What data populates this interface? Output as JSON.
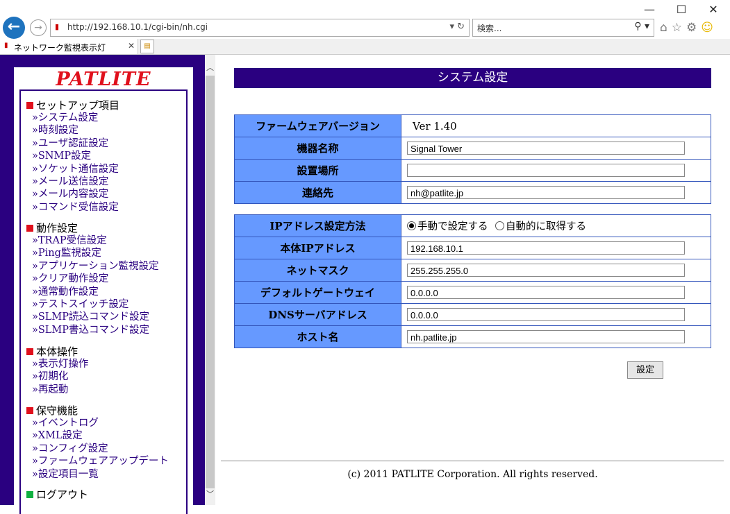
{
  "browser": {
    "url_host": "http://192.168.10.1",
    "url_path": "/cgi-bin/nh.cgi",
    "search_placeholder": "検索...",
    "tab_title": "ネットワーク監視表示灯"
  },
  "sidebar": {
    "logo": "PATLITE",
    "sections": [
      {
        "head": "セットアップ項目",
        "marker": "red",
        "items": [
          "»システム設定",
          "»時刻設定",
          "»ユーザ認証設定",
          "»SNMP設定",
          "»ソケット通信設定",
          "»メール送信設定",
          "»メール内容設定",
          "»コマンド受信設定"
        ]
      },
      {
        "head": "動作設定",
        "marker": "red",
        "items": [
          "»TRAP受信設定",
          "»Ping監視設定",
          "»アプリケーション監視設定",
          "»クリア動作設定",
          "»通常動作設定",
          "»テストスイッチ設定",
          "»SLMP読込コマンド設定",
          "»SLMP書込コマンド設定"
        ]
      },
      {
        "head": "本体操作",
        "marker": "red",
        "items": [
          "»表示灯操作",
          "»初期化",
          "»再起動"
        ]
      },
      {
        "head": "保守機能",
        "marker": "red",
        "items": [
          "»イベントログ",
          "»XML設定",
          "»コンフィグ設定",
          "»ファームウェアアップデート",
          "»設定項目一覧"
        ]
      },
      {
        "head": "ログアウト",
        "marker": "green",
        "items": []
      }
    ]
  },
  "main": {
    "title": "システム設定",
    "table1": {
      "firmware_label": "ファームウェアバージョン",
      "firmware_value": "Ver 1.40",
      "device_name_label": "機器名称",
      "device_name_value": "Signal Tower",
      "location_label": "設置場所",
      "location_value": "",
      "contact_label": "連絡先",
      "contact_value": "nh@patlite.jp"
    },
    "table2": {
      "ip_method_label": "IPアドレス設定方法",
      "ip_manual_label": "手動で設定する",
      "ip_auto_label": "自動的に取得する",
      "ip_method_selected": "manual",
      "ip_label": "本体IPアドレス",
      "ip_value": "192.168.10.1",
      "netmask_label": "ネットマスク",
      "netmask_value": "255.255.255.0",
      "gateway_label": "デフォルトゲートウェイ",
      "gateway_value": "0.0.0.0",
      "dns_label": "DNSサーバアドレス",
      "dns_value": "0.0.0.0",
      "hostname_label": "ホスト名",
      "hostname_value": "nh.patlite.jp"
    },
    "submit_label": "設定",
    "copyright": "(c) 2011 PATLITE Corporation. All rights reserved."
  }
}
